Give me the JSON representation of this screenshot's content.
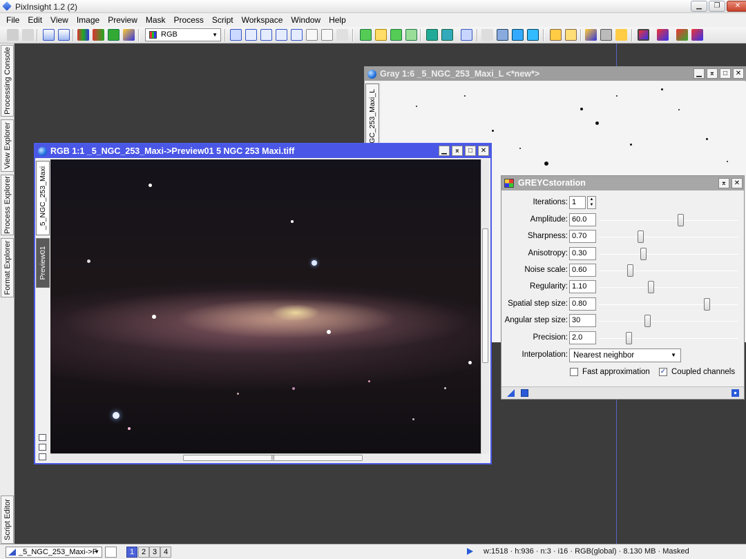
{
  "app": {
    "title": "PixInsight 1.2 (2)"
  },
  "menu": [
    "File",
    "Edit",
    "View",
    "Image",
    "Preview",
    "Mask",
    "Process",
    "Script",
    "Workspace",
    "Window",
    "Help"
  ],
  "toolbar": {
    "color_space": "RGB"
  },
  "side_tabs": [
    "Processing Console",
    "View Explorer",
    "Process Explorer",
    "Format Explorer",
    "Script Editor"
  ],
  "rgb_window": {
    "title": "RGB 1:1 _5_NGC_253_Maxi->Preview01 5 NGC 253 Maxi.tiff",
    "tabs": [
      "_5_NGC_253_Maxi",
      "Preview01"
    ]
  },
  "gray_window": {
    "title": "Gray 1:6 _5_NGC_253_Maxi_L <*new*>",
    "tabs": [
      "_5_NGC_253_Maxi_L"
    ]
  },
  "greyc": {
    "title": "GREYCstoration",
    "params": [
      {
        "label": "Iterations:",
        "value": "1"
      },
      {
        "label": "Amplitude:",
        "value": "60.0",
        "slider": 0.59
      },
      {
        "label": "Sharpness:",
        "value": "0.70",
        "slider": 0.29
      },
      {
        "label": "Anisotropy:",
        "value": "0.30",
        "slider": 0.31
      },
      {
        "label": "Noise scale:",
        "value": "0.60",
        "slider": 0.21
      },
      {
        "label": "Regularity:",
        "value": "1.10",
        "slider": 0.37
      },
      {
        "label": "Spatial step size:",
        "value": "0.80",
        "slider": 0.79
      },
      {
        "label": "Angular step size:",
        "value": "30",
        "slider": 0.34
      },
      {
        "label": "Precision:",
        "value": "2.0",
        "slider": 0.2
      }
    ],
    "interpolation_label": "Interpolation:",
    "interpolation_value": "Nearest neighbor",
    "fast_approx_label": "Fast approximation",
    "coupled_channels_label": "Coupled channels"
  },
  "status": {
    "view": "_5_NGC_253_Maxi->F",
    "workspaces": [
      "1",
      "2",
      "3",
      "4"
    ],
    "info": "w:1518 · h:936 · n:3 · i16 · RGB(global) · 8.130 MB · Masked"
  }
}
